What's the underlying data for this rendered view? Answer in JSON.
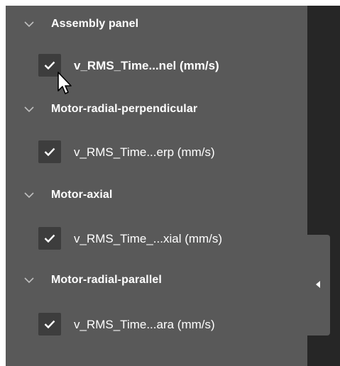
{
  "groups": [
    {
      "label": "Assembly panel",
      "item": {
        "label": "v_RMS_Time...nel (mm/s)",
        "checked": true
      }
    },
    {
      "label": "Motor-radial-perpendicular",
      "item": {
        "label": "v_RMS_Time...erp (mm/s)",
        "checked": true
      }
    },
    {
      "label": "Motor-axial",
      "item": {
        "label": "v_RMS_Time_...xial (mm/s)",
        "checked": true
      }
    },
    {
      "label": "Motor-radial-parallel",
      "item": {
        "label": "v_RMS_Time...ara (mm/s)",
        "checked": true
      }
    }
  ],
  "icons": {
    "group_toggle": "chevron-down-icon",
    "check": "checkmark-icon",
    "collapse": "triangle-left-icon",
    "pointer": "mouse-pointer-icon"
  },
  "colors": {
    "panel_bg": "#595959",
    "strip_bg": "#262626",
    "checkbox_bg": "#3d3d3d",
    "text": "#ffffff",
    "chevron": "#bfbfbf"
  }
}
